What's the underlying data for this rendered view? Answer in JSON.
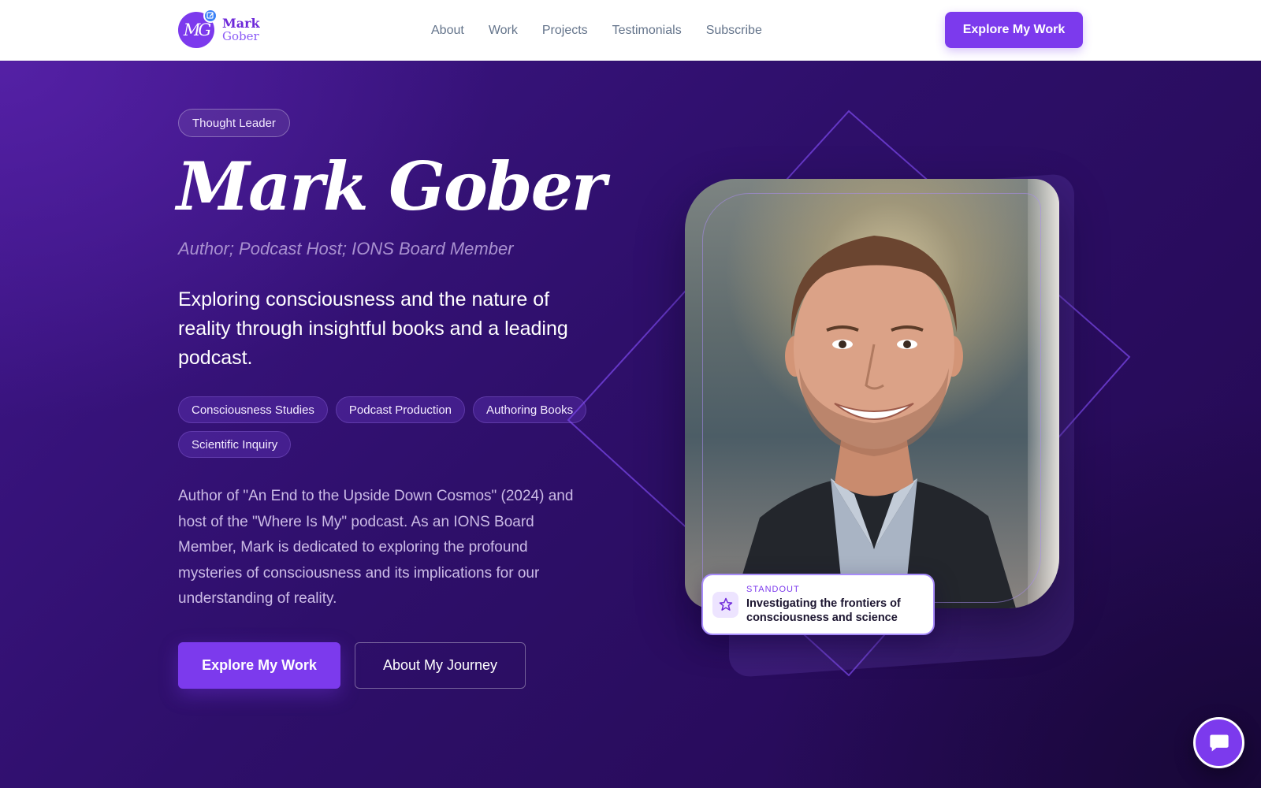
{
  "brand": {
    "monogram": "MG",
    "first": "Mark",
    "last": "Gober"
  },
  "nav": {
    "items": [
      {
        "label": "About"
      },
      {
        "label": "Work"
      },
      {
        "label": "Projects"
      },
      {
        "label": "Testimonials"
      },
      {
        "label": "Subscribe"
      }
    ],
    "cta": "Explore My Work"
  },
  "hero": {
    "tag": "Thought Leader",
    "name": "Mark Gober",
    "role": "Author; Podcast Host; IONS Board Member",
    "tagline": "Exploring consciousness and the nature of reality through insightful books and a leading podcast.",
    "chips": [
      "Consciousness Studies",
      "Podcast Production",
      "Authoring Books",
      "Scientific Inquiry"
    ],
    "bio": "Author of \"An End to the Upside Down Cosmos\" (2024) and host of the \"Where Is My\" podcast. As an IONS Board Member, Mark is dedicated to exploring the profound mysteries of consciousness and its implications for our understanding of reality.",
    "primary_cta": "Explore My Work",
    "secondary_cta": "About My Journey"
  },
  "standout": {
    "kicker": "STANDOUT",
    "text": "Investigating the frontiers of consciousness and science",
    "icon": "star-icon"
  },
  "chat": {
    "icon": "chat-bubble-icon"
  },
  "colors": {
    "accent": "#7c3aed",
    "hero_bg": "#2e0f6a",
    "nav_text": "#64748b"
  }
}
